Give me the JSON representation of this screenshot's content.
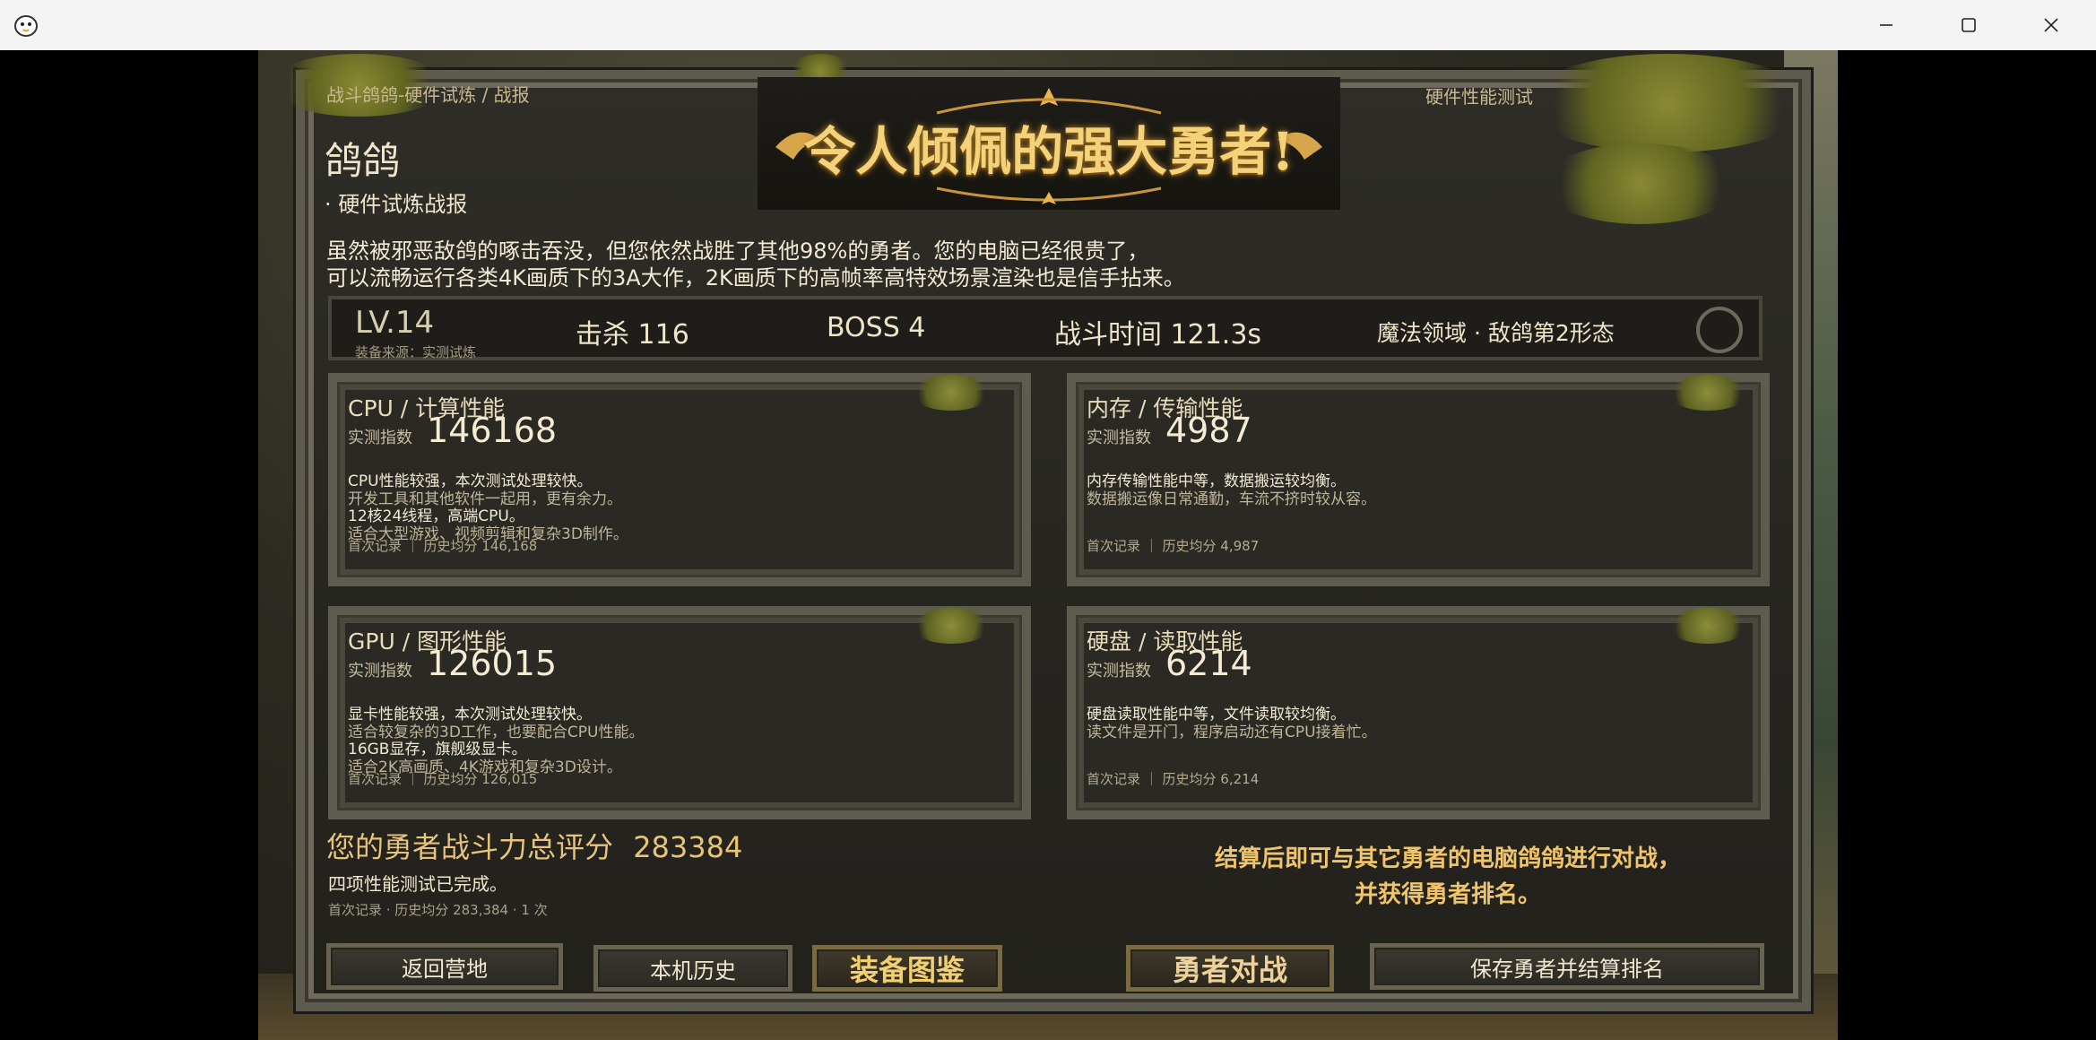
{
  "window": {
    "minimize": "—",
    "maximize": "☐",
    "close": "✕"
  },
  "breadcrumb": {
    "path": "战斗鸽鸽-硬件试炼 / 战报",
    "section": "硬件性能测试"
  },
  "banner": "令人倾佩的强大勇者!",
  "player": {
    "name": "鸽鸽",
    "subtitle": "· 硬件试炼战报"
  },
  "description": [
    "虽然被邪恶敌鸽的啄击吞没，但您依然战胜了其他98%的勇者。您的电脑已经很贵了，",
    "可以流畅运行各类4K画质下的3A大作，2K画质下的高帧率高特效场景渲染也是信手拈来。"
  ],
  "stats": {
    "level": "LV.14",
    "equip_source": "装备来源：实测试炼",
    "kills": "击杀 116",
    "boss": "BOSS 4",
    "battle_time": "战斗时间 121.3s",
    "stage": "魔法领域 · 敌鸽第2形态"
  },
  "cards": [
    {
      "title": "CPU / 计算性能",
      "label": "实测指数",
      "value": "146168",
      "lines": [
        {
          "text": "CPU性能较强，本次测试处理较快。",
          "style": "l1"
        },
        {
          "text": "开发工具和其他软件一起用，更有余力。",
          "style": "l2"
        },
        {
          "text": "12核24线程，高端CPU。",
          "style": "l1"
        },
        {
          "text": "适合大型游戏、视频剪辑和复杂3D制作。",
          "style": "l2"
        }
      ],
      "footer": "首次记录 ｜ 历史均分 146,168"
    },
    {
      "title": "内存 / 传输性能",
      "label": "实测指数",
      "value": "4987",
      "lines": [
        {
          "text": "内存传输性能中等，数据搬运较均衡。",
          "style": "l1"
        },
        {
          "text": "数据搬运像日常通勤，车流不挤时较从容。",
          "style": "l2"
        }
      ],
      "footer": "首次记录 ｜ 历史均分 4,987"
    },
    {
      "title": "GPU / 图形性能",
      "label": "实测指数",
      "value": "126015",
      "lines": [
        {
          "text": "显卡性能较强，本次测试处理较快。",
          "style": "l1"
        },
        {
          "text": "适合较复杂的3D工作，也要配合CPU性能。",
          "style": "l2"
        },
        {
          "text": "16GB显存，旗舰级显卡。",
          "style": "l1"
        },
        {
          "text": "适合2K高画质、4K游戏和复杂3D设计。",
          "style": "l2"
        }
      ],
      "footer": "首次记录 ｜ 历史均分 126,015"
    },
    {
      "title": "硬盘 / 读取性能",
      "label": "实测指数",
      "value": "6214",
      "lines": [
        {
          "text": "硬盘读取性能中等，文件读取较均衡。",
          "style": "l1"
        },
        {
          "text": "读文件是开门，程序启动还有CPU接着忙。",
          "style": "l2"
        }
      ],
      "footer": "首次记录 ｜ 历史均分 6,214"
    }
  ],
  "total": {
    "label": "您的勇者战斗力总评分",
    "score": "283384",
    "note": "四项性能测试已完成。",
    "footer": "首次记录 · 历史均分 283,384 · 1 次"
  },
  "promo": [
    "结算后即可与其它勇者的电脑鸽鸽进行对战，",
    "并获得勇者排名。"
  ],
  "buttons": {
    "back": "返回营地",
    "history": "本机历史",
    "gallery": "装备图鉴",
    "battle": "勇者对战",
    "save": "保存勇者并结算排名"
  }
}
